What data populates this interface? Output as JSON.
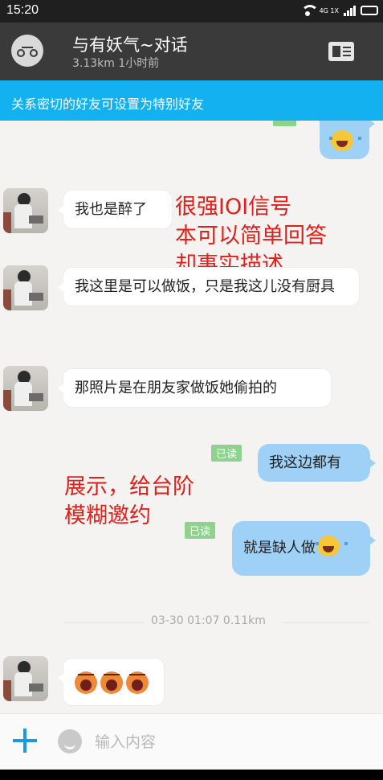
{
  "status_bar": {
    "time": "15:20",
    "network": "4G 1X"
  },
  "header": {
    "title": "与有妖气~对话",
    "subtitle": "3.13km 1小时前",
    "avatar_icon": "bike-icon",
    "profile_icon": "profile-card-icon"
  },
  "banner": {
    "text": "关系密切的好友可设置为特别好友"
  },
  "messages": [
    {
      "side": "left",
      "text": "我也是醉了"
    },
    {
      "side": "left",
      "text": "我这里是可以做饭，只是我这儿没有厨具"
    },
    {
      "side": "left",
      "text": "那照片是在朋友家做饭她偷拍的"
    },
    {
      "side": "right",
      "text": "我这边都有",
      "read": "已读"
    },
    {
      "side": "right",
      "text": "就是缺人做",
      "read": "已读"
    },
    {
      "side": "left",
      "text": ""
    }
  ],
  "timestamp": "03-30 01:07   0.11km",
  "annotations": {
    "a1_line1": "很强IOI信号",
    "a1_line2": "本可以简单回答",
    "a1_line3": "却事实描述",
    "a2_line1": "展示，给台阶",
    "a2_line2": "模糊邀约"
  },
  "input": {
    "placeholder": "输入内容"
  },
  "colors": {
    "accent": "#14b1f0",
    "header": "#3a3a3a",
    "self_bubble": "#9fd0f5",
    "read_tag": "#8fd18f",
    "annotation": "#e0201a"
  }
}
